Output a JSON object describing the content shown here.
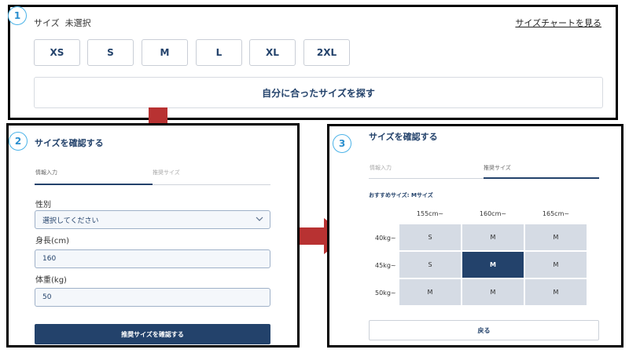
{
  "steps": [
    "1",
    "2",
    "3"
  ],
  "size_selector": {
    "label": "サイズ",
    "status": "未選択",
    "chart_link": "サイズチャートを見る",
    "sizes": [
      "XS",
      "S",
      "M",
      "L",
      "XL",
      "2XL"
    ],
    "find_size_button": "自分に合ったサイズを探す"
  },
  "form_panel": {
    "title": "サイズを確認する",
    "tabs": [
      "情報入力",
      "推奨サイズ"
    ],
    "gender_label": "性別",
    "gender_select": "選択してください",
    "height_label": "身長(cm)",
    "height_value": "160",
    "weight_label": "体重(kg)",
    "weight_value": "50",
    "submit_button": "推奨サイズを確認する"
  },
  "result_panel": {
    "title": "サイズを確認する",
    "tabs": [
      "情報入力",
      "推奨サイズ"
    ],
    "recommended": "おすすめサイズ: Mサイズ",
    "columns": [
      "155cm~",
      "160cm~",
      "165cm~"
    ],
    "rows": [
      {
        "label": "40kg~",
        "cells": [
          "S",
          "M",
          "M"
        ]
      },
      {
        "label": "45kg~",
        "cells": [
          "S",
          "M",
          "M"
        ]
      },
      {
        "label": "50kg~",
        "cells": [
          "M",
          "M",
          "M"
        ]
      }
    ],
    "back_button": "戻る"
  },
  "colors": {
    "accent": "#23426b",
    "step_circle": "#4bb3e8",
    "arrow": "#b83232",
    "cell_bg": "#d5dbe4"
  }
}
